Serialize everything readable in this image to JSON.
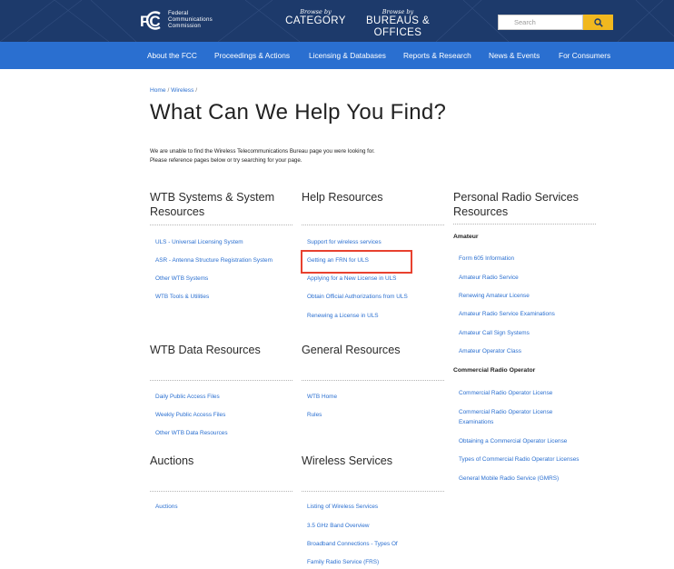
{
  "header": {
    "logo_lines": [
      "Federal",
      "Communications",
      "Commission"
    ],
    "browse_category_small": "Browse by",
    "browse_category_big": "CATEGORY",
    "browse_bureaus_small": "Browse by",
    "browse_bureaus_big": "BUREAUS & OFFICES",
    "search_placeholder": "Search"
  },
  "nav": [
    "About the FCC",
    "Proceedings & Actions",
    "Licensing & Databases",
    "Reports & Research",
    "News & Events",
    "For Consumers"
  ],
  "breadcrumb": {
    "home": "Home",
    "sep": "/",
    "current": "Wireless",
    "sep2": "/"
  },
  "page_title": "What Can We Help You Find?",
  "notice": [
    "We are unable to find the Wireless Telecommunications Bureau page you were looking for.",
    "Please reference pages below or try searching for your page."
  ],
  "sections": {
    "wtb_systems": {
      "title_lines": [
        "WTB Systems & System",
        "Resources"
      ],
      "links": [
        "ULS - Universal Licensing System",
        "ASR - Antenna Structure Registration System",
        "Other WTB Systems",
        "WTB Tools & Utilities"
      ]
    },
    "help": {
      "title": "Help Resources",
      "links": [
        "Support for wireless services",
        "Getting an FRN for ULS",
        "Applying for a New License in ULS",
        "Obtain Official Authorizations from ULS",
        "Renewing a License in ULS"
      ]
    },
    "personal_radio": {
      "title_lines": [
        "Personal Radio Services",
        "Resources"
      ],
      "amateur_head": "Amateur",
      "amateur_links": [
        "Form 605 Information",
        "Amateur Radio Service",
        "Renewing Amateur License",
        "Amateur Radio Service Examinations",
        "Amateur Call Sign Systems",
        "Amateur Operator Class"
      ],
      "commercial_head": "Commercial Radio Operator",
      "commercial_links": [
        "Commercial Radio Operator License",
        "Commercial Radio Operator License",
        "Examinations",
        "Obtaining a Commercial Operator License",
        "Types of Commercial Radio Operator Licenses",
        "General Mobile Radio Service (GMRS)"
      ]
    },
    "wtb_data": {
      "title": "WTB Data Resources",
      "links": [
        "Daily Public Access Files",
        "Weekly Public Access Files",
        "Other WTB Data Resources"
      ]
    },
    "general": {
      "title": "General Resources",
      "links": [
        "WTB Home",
        "Rules"
      ]
    },
    "auctions": {
      "title": "Auctions",
      "links": [
        "Auctions"
      ]
    },
    "wireless_services": {
      "title": "Wireless Services",
      "links": [
        "Listing of Wireless Services",
        "3.5 GHz Band Overview",
        "Broadband Connections - Types Of",
        "Family Radio Service (FRS)"
      ]
    }
  },
  "colors": {
    "header_bg": "#1d3a6b",
    "nav_bg": "#2a6fd0",
    "link": "#2a6fd0",
    "search_btn": "#f1b81f",
    "highlight": "#e8412f"
  }
}
